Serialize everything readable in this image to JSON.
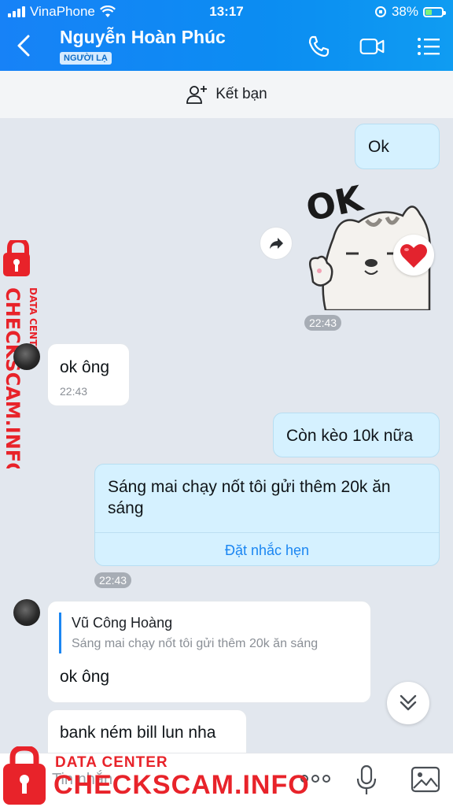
{
  "status_bar": {
    "carrier": "VinaPhone",
    "time": "13:17",
    "battery": "38%",
    "battery_level": 0.38
  },
  "header": {
    "contact_name": "Nguyễn Hoàn Phúc",
    "stranger_badge": "NGƯỜI LẠ",
    "icons": [
      "back-arrow-icon",
      "phone-icon",
      "video-call-icon",
      "menu-icon"
    ]
  },
  "add_friend": {
    "label": "Kết bạn"
  },
  "messages": {
    "m1": {
      "text": "Ok"
    },
    "sticker": {
      "text": "OK",
      "time": "22:43",
      "reaction": "heart"
    },
    "m2": {
      "text": "ok ông",
      "time": "22:43"
    },
    "m3": {
      "text": "Còn kèo 10k nữa"
    },
    "m4": {
      "text": "Sáng mai chạy nốt tôi gửi thêm 20k ăn sáng",
      "action": "Đặt nhắc hẹn",
      "time": "22:43"
    },
    "m5": {
      "reply_author": "Vũ Công Hoàng",
      "reply_quote": "Sáng mai chạy nốt tôi gửi thêm 20k ăn sáng",
      "text": "ok ông"
    },
    "m6": {
      "text": "bank ném bill lun nha"
    }
  },
  "input": {
    "placeholder": "Tin nhắn"
  },
  "watermark": {
    "line1": "DATA CENTER",
    "line2": "CHECKSCAM.INFO"
  },
  "colors": {
    "header": "#1782f7",
    "my_bubble": "#d5f1ff",
    "watermark": "#e8232a"
  }
}
